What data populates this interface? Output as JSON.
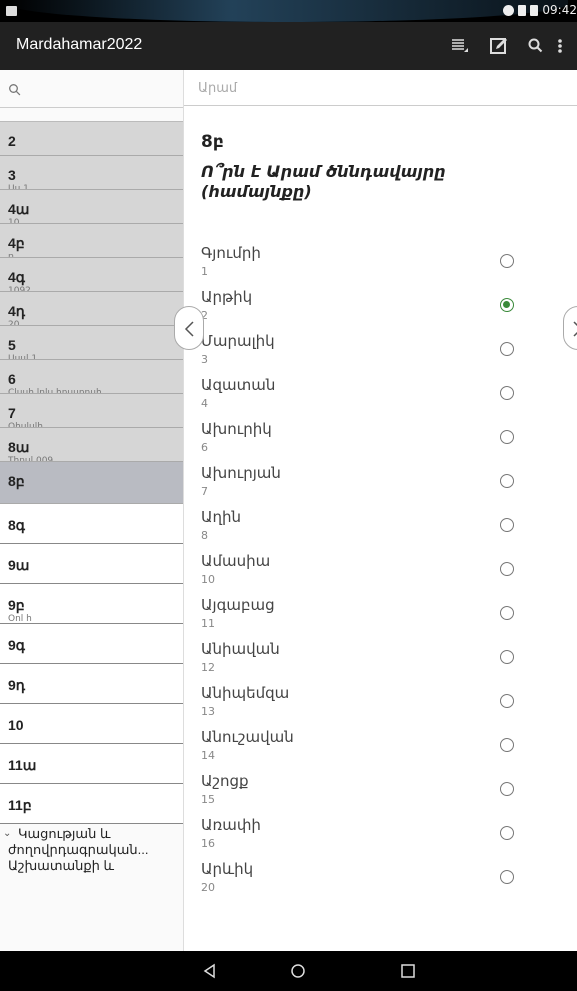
{
  "status_bar": {
    "time": "09:42"
  },
  "app_bar": {
    "title": "Mardahamar2022",
    "icons": [
      "sort-icon",
      "edit-icon",
      "search-icon",
      "more-vert-icon"
    ]
  },
  "sidebar": {
    "search_placeholder": "",
    "items": [
      {
        "label": "2",
        "sub": "",
        "style": "gray"
      },
      {
        "label": "3",
        "sub": "Uu 1",
        "style": "gray"
      },
      {
        "label": "4ա",
        "sub": "10",
        "style": "gray"
      },
      {
        "label": "4բ",
        "sub": "ռ",
        "style": "gray"
      },
      {
        "label": "4գ",
        "sub": "1092",
        "style": "gray"
      },
      {
        "label": "4դ",
        "sub": "20",
        "style": "gray"
      },
      {
        "label": "5",
        "sub": "Uuul 1",
        "style": "gray"
      },
      {
        "label": "6",
        "sub": "Cluuh lnlu hnuunnuh",
        "style": "gray"
      },
      {
        "label": "7",
        "sub": "Ohululh",
        "style": "gray"
      },
      {
        "label": "8ա",
        "sub": "Thnul 009",
        "style": "gray"
      },
      {
        "label": "8բ",
        "sub": "",
        "style": "active"
      },
      {
        "label": "8գ",
        "sub": "",
        "style": "white"
      },
      {
        "label": "9ա",
        "sub": "",
        "style": "white"
      },
      {
        "label": "9բ",
        "sub": "Onl h",
        "style": "white"
      },
      {
        "label": "9գ",
        "sub": "",
        "style": "white"
      },
      {
        "label": "9դ",
        "sub": "",
        "style": "white"
      },
      {
        "label": "10",
        "sub": "",
        "style": "white"
      },
      {
        "label": "11ա",
        "sub": "",
        "style": "white"
      },
      {
        "label": "11բ",
        "sub": "",
        "style": "white"
      }
    ],
    "group": {
      "line1": "Կացության և",
      "line2": "ժողովրդագրական...",
      "line3": "Աշխատանքի և"
    }
  },
  "main": {
    "filter_text": "Արամ",
    "question_number": "8բ",
    "question_text": "Ո՞րն է Արամ ծննդավայրը (համայնքը)",
    "selected_index": 1,
    "options": [
      {
        "label": "Գյումրի",
        "num": "1"
      },
      {
        "label": "Արթիկ",
        "num": "2"
      },
      {
        "label": "Մարալիկ",
        "num": "3"
      },
      {
        "label": "Ազատան",
        "num": "4"
      },
      {
        "label": "Ախուրիկ",
        "num": "6"
      },
      {
        "label": "Ախուրյան",
        "num": "7"
      },
      {
        "label": "Աղին",
        "num": "8"
      },
      {
        "label": "Ամասիա",
        "num": "10"
      },
      {
        "label": "Այգաբաց",
        "num": "11"
      },
      {
        "label": "Անիավան",
        "num": "12"
      },
      {
        "label": "Անիպեմզա",
        "num": "13"
      },
      {
        "label": "Անուշավան",
        "num": "14"
      },
      {
        "label": "Աշոցք",
        "num": "15"
      },
      {
        "label": "Առափի",
        "num": "16"
      },
      {
        "label": "Արևիկ",
        "num": "20"
      }
    ]
  },
  "colors": {
    "app_bar": "#212121",
    "active_item": "#b9bbc2",
    "gray_item": "#d6d6d6",
    "radio_checked": "#3a8a3a"
  }
}
